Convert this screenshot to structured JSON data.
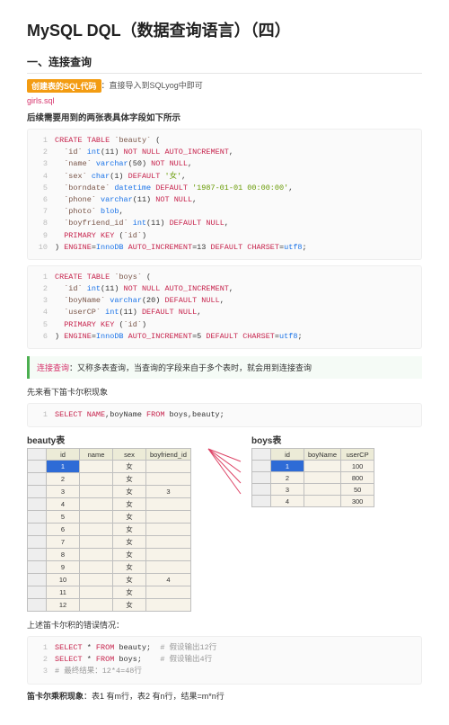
{
  "title": "MySQL DQL（数据查询语言）（四）",
  "section1": "一、连接查询",
  "tagLabel": "创建表的SQL代码",
  "tagSuffix": "：直接导入到SQLyog中即可",
  "link": "girls.sql",
  "boldIntro": "后续需要用到的两张表具体字段如下所示",
  "code1": {
    "lines": [
      {
        "n": "1",
        "t": "CREATE TABLE `beauty` ("
      },
      {
        "n": "2",
        "t": "  `id` int(11) NOT NULL AUTO_INCREMENT,"
      },
      {
        "n": "3",
        "t": "  `name` varchar(50) NOT NULL,"
      },
      {
        "n": "4",
        "t": "  `sex` char(1) DEFAULT '女',"
      },
      {
        "n": "5",
        "t": "  `borndate` datetime DEFAULT '1987-01-01 00:00:00',"
      },
      {
        "n": "6",
        "t": "  `phone` varchar(11) NOT NULL,"
      },
      {
        "n": "7",
        "t": "  `photo` blob,"
      },
      {
        "n": "8",
        "t": "  `boyfriend_id` int(11) DEFAULT NULL,"
      },
      {
        "n": "9",
        "t": "  PRIMARY KEY (`id`)"
      },
      {
        "n": "10",
        "t": ") ENGINE=InnoDB AUTO_INCREMENT=13 DEFAULT CHARSET=utf8;"
      }
    ]
  },
  "code2": {
    "lines": [
      {
        "n": "1",
        "t": "CREATE TABLE `boys` ("
      },
      {
        "n": "2",
        "t": "  `id` int(11) NOT NULL AUTO_INCREMENT,"
      },
      {
        "n": "3",
        "t": "  `boyName` varchar(20) DEFAULT NULL,"
      },
      {
        "n": "4",
        "t": "  `userCP` int(11) DEFAULT NULL,"
      },
      {
        "n": "5",
        "t": "  PRIMARY KEY (`id`)"
      },
      {
        "n": "6",
        "t": ") ENGINE=InnoDB AUTO_INCREMENT=5 DEFAULT CHARSET=utf8;"
      }
    ]
  },
  "calloutTerm": "连接查询",
  "calloutText": "：又称多表查询，当查询的字段来自于多个表时，就会用到连接查询",
  "para2": "先来看下笛卡尔积现象",
  "code3": {
    "lines": [
      {
        "n": "1",
        "t": "SELECT NAME,boyName FROM boys,beauty;"
      }
    ]
  },
  "beautyTitle": "beauty表",
  "boysTitle": "boys表",
  "beautyHeaders": [
    "id",
    "name",
    "sex",
    "boyfriend_id"
  ],
  "beautyRows": [
    [
      "1",
      "",
      "女",
      ""
    ],
    [
      "2",
      "",
      "女",
      ""
    ],
    [
      "3",
      "",
      "女",
      "3"
    ],
    [
      "4",
      "",
      "女",
      ""
    ],
    [
      "5",
      "",
      "女",
      ""
    ],
    [
      "6",
      "",
      "女",
      ""
    ],
    [
      "7",
      "",
      "女",
      ""
    ],
    [
      "8",
      "",
      "女",
      ""
    ],
    [
      "9",
      "",
      "女",
      ""
    ],
    [
      "10",
      "",
      "女",
      "4"
    ],
    [
      "11",
      "",
      "女",
      ""
    ],
    [
      "12",
      "",
      "女",
      ""
    ]
  ],
  "boysHeaders": [
    "id",
    "boyName",
    "userCP"
  ],
  "boysRows": [
    [
      "1",
      "",
      "100"
    ],
    [
      "2",
      "",
      "800"
    ],
    [
      "3",
      "",
      "50"
    ],
    [
      "4",
      "",
      "300"
    ]
  ],
  "para3": "上述笛卡尔积的错误情况：",
  "code4": {
    "lines": [
      {
        "n": "1",
        "t": "SELECT * FROM beauty;  # 假设输出12行"
      },
      {
        "n": "2",
        "t": "SELECT * FROM boys;    # 假设输出4行"
      },
      {
        "n": "3",
        "t": "# 最终结果：12*4=48行"
      }
    ]
  },
  "finalBold": "笛卡尔乘积现象",
  "finalRest": "：表1 有m行，表2 有n行，结果=m*n行"
}
